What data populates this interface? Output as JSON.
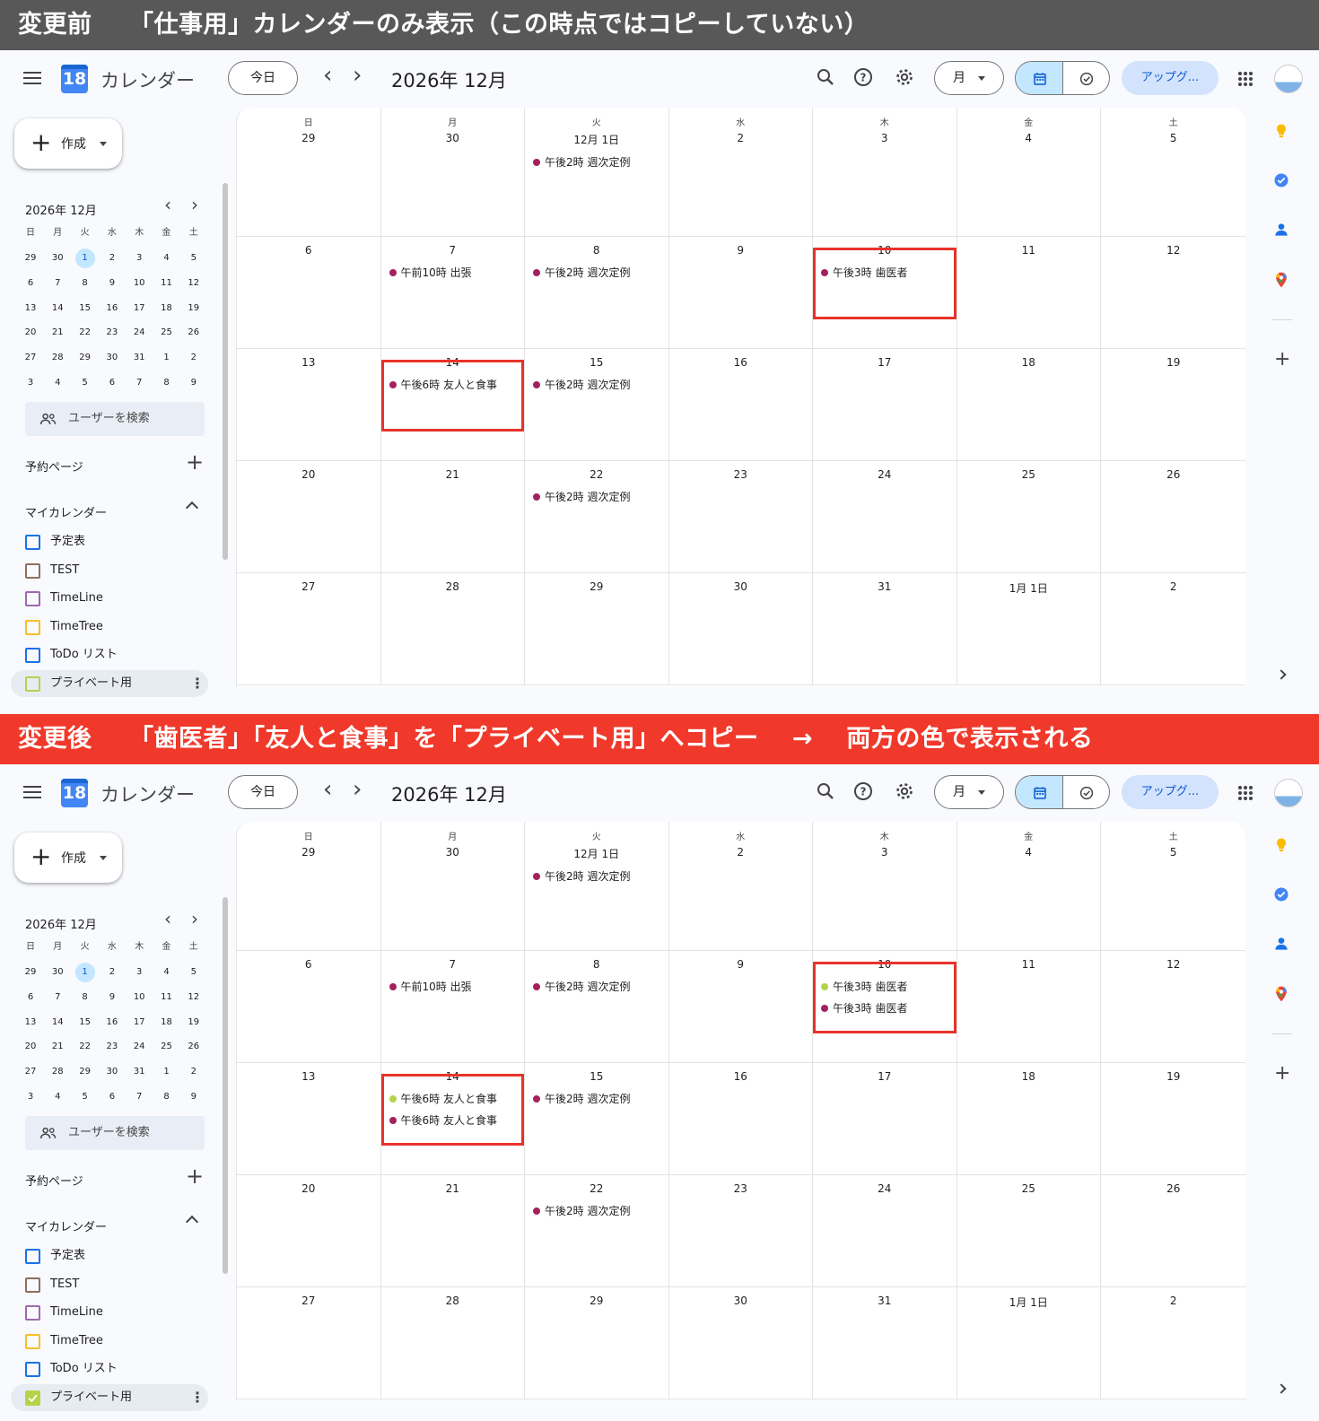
{
  "banners": {
    "before": "変更前　　「仕事用」カレンダーのみ表示（この時点ではコピーしていない）",
    "after": "変更後　　「歯医者」「友人と食事」を「プライベート用」へコピー　 →　 両方の色で表示される"
  },
  "colors": {
    "work_event": "#a4215d",
    "private_event": "#b5d34a",
    "highlight_box": "#e8332a",
    "accent": "#0b57d0"
  },
  "header": {
    "app_title": "カレンダー",
    "logo_day": "18",
    "today_label": "今日",
    "month_title": "2026年 12月",
    "view_label": "月",
    "upgrade_label": "アップグ..."
  },
  "sidebar": {
    "create_label": "作成",
    "mini_title": "2026年 12月",
    "weekdays": [
      "日",
      "月",
      "火",
      "水",
      "木",
      "金",
      "土"
    ],
    "mini_weeks": [
      [
        "29",
        "30",
        "1",
        "2",
        "3",
        "4",
        "5"
      ],
      [
        "6",
        "7",
        "8",
        "9",
        "10",
        "11",
        "12"
      ],
      [
        "13",
        "14",
        "15",
        "16",
        "17",
        "18",
        "19"
      ],
      [
        "20",
        "21",
        "22",
        "23",
        "24",
        "25",
        "26"
      ],
      [
        "27",
        "28",
        "29",
        "30",
        "31",
        "1",
        "2"
      ],
      [
        "3",
        "4",
        "5",
        "6",
        "7",
        "8",
        "9"
      ]
    ],
    "selected_day": "1",
    "people_search": "ユーザーを検索",
    "booking_label": "予約ページ",
    "my_calendars_label": "マイカレンダー",
    "calendars": [
      {
        "name": "予定表",
        "color": "#1a73e8"
      },
      {
        "name": "TEST",
        "color": "#8d6e63"
      },
      {
        "name": "TimeLine",
        "color": "#9e69af"
      },
      {
        "name": "TimeTree",
        "color": "#f6bf26"
      },
      {
        "name": "ToDo リスト",
        "color": "#1a73e8"
      },
      {
        "name": "プライベート用",
        "color": "#b5d34a"
      }
    ]
  },
  "month": {
    "weekday_headers": [
      "日",
      "月",
      "火",
      "水",
      "木",
      "金",
      "土"
    ],
    "weeks": [
      [
        "29",
        "30",
        "12月 1日",
        "2",
        "3",
        "4",
        "5"
      ],
      [
        "6",
        "7",
        "8",
        "9",
        "10",
        "11",
        "12"
      ],
      [
        "13",
        "14",
        "15",
        "16",
        "17",
        "18",
        "19"
      ],
      [
        "20",
        "21",
        "22",
        "23",
        "24",
        "25",
        "26"
      ],
      [
        "27",
        "28",
        "29",
        "30",
        "31",
        "1月 1日",
        "2"
      ]
    ]
  },
  "panels": {
    "before": {
      "private_checked": false,
      "events": [
        {
          "week": 0,
          "day": 2,
          "text": "午後2時 週次定例",
          "calendar": "work"
        },
        {
          "week": 1,
          "day": 1,
          "text": "午前10時 出張",
          "calendar": "work"
        },
        {
          "week": 1,
          "day": 2,
          "text": "午後2時 週次定例",
          "calendar": "work"
        },
        {
          "week": 1,
          "day": 4,
          "text": "午後3時 歯医者",
          "calendar": "work"
        },
        {
          "week": 2,
          "day": 1,
          "text": "午後6時 友人と食事",
          "calendar": "work"
        },
        {
          "week": 2,
          "day": 2,
          "text": "午後2時 週次定例",
          "calendar": "work"
        },
        {
          "week": 3,
          "day": 2,
          "text": "午後2時 週次定例",
          "calendar": "work"
        }
      ],
      "highlights": [
        {
          "week": 1,
          "day": 4
        },
        {
          "week": 2,
          "day": 1
        }
      ]
    },
    "after": {
      "private_checked": true,
      "events": [
        {
          "week": 0,
          "day": 2,
          "text": "午後2時 週次定例",
          "calendar": "work"
        },
        {
          "week": 1,
          "day": 1,
          "text": "午前10時 出張",
          "calendar": "work"
        },
        {
          "week": 1,
          "day": 2,
          "text": "午後2時 週次定例",
          "calendar": "work"
        },
        {
          "week": 1,
          "day": 4,
          "text": "午後3時 歯医者",
          "calendar": "private"
        },
        {
          "week": 1,
          "day": 4,
          "text": "午後3時 歯医者",
          "calendar": "work"
        },
        {
          "week": 2,
          "day": 1,
          "text": "午後6時 友人と食事",
          "calendar": "private"
        },
        {
          "week": 2,
          "day": 1,
          "text": "午後6時 友人と食事",
          "calendar": "work"
        },
        {
          "week": 2,
          "day": 2,
          "text": "午後2時 週次定例",
          "calendar": "work"
        },
        {
          "week": 3,
          "day": 2,
          "text": "午後2時 週次定例",
          "calendar": "work"
        }
      ],
      "highlights": [
        {
          "week": 1,
          "day": 4
        },
        {
          "week": 2,
          "day": 1
        }
      ]
    }
  }
}
